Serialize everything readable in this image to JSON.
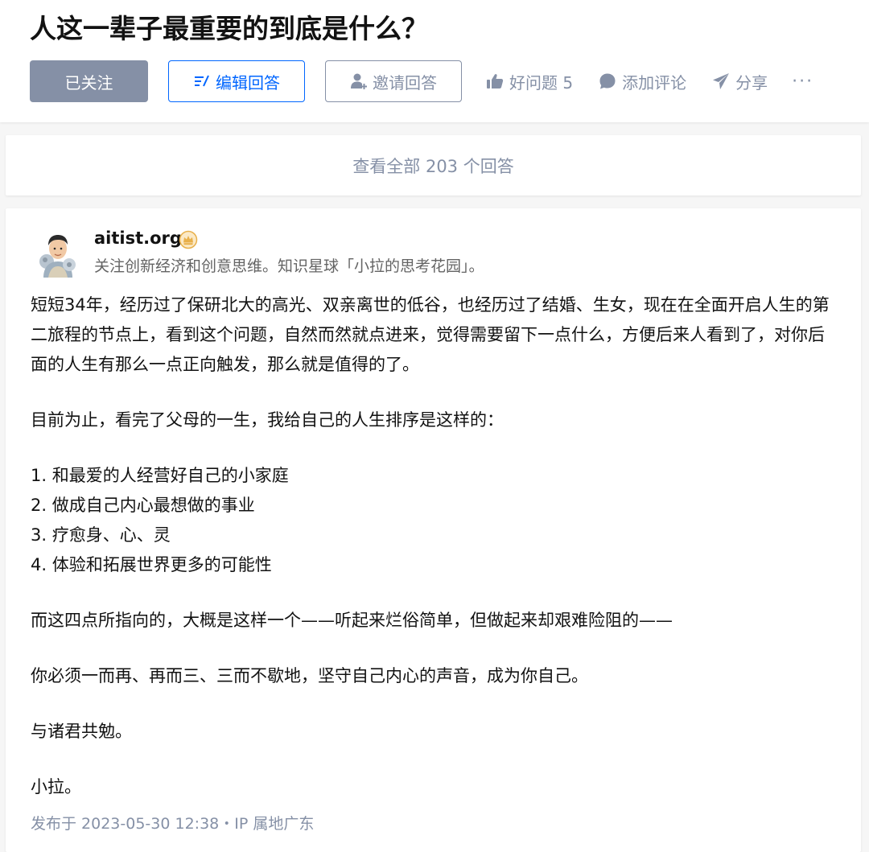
{
  "question": {
    "title": "人这一辈子最重要的到底是什么？"
  },
  "actions": {
    "follow_label": "已关注",
    "edit_label": "编辑回答",
    "invite_label": "邀请回答",
    "good_question_label": "好问题 5",
    "comment_label": "添加评论",
    "share_label": "分享",
    "more_label": "···"
  },
  "view_all": {
    "label": "查看全部 203 个回答"
  },
  "answer": {
    "author": {
      "name": "aitist.org",
      "bio": "关注创新经济和创意思维。知识星球「小拉的思考花园」。"
    },
    "paragraphs": {
      "p1": "短短34年，经历过了保研北大的高光、双亲离世的低谷，也经历过了结婚、生女，现在在全面开启人生的第二旅程的节点上，看到这个问题，自然而然就点进来，觉得需要留下一点什么，方便后来人看到了，对你后面的人生有那么一点正向触发，那么就是值得的了。",
      "p2": "目前为止，看完了父母的一生，我给自己的人生排序是这样的：",
      "list": [
        "1. 和最爱的人经营好自己的小家庭",
        "2. 做成自己内心最想做的事业",
        "3. 疗愈身、心、灵",
        "4. 体验和拓展世界更多的可能性"
      ],
      "p3": "而这四点所指向的，大概是这样一个——听起来烂俗简单，但做起来却艰难险阻的——",
      "p4": "你必须一而再、再而三、三而不歇地，坚守自己内心的声音，成为你自己。",
      "p5": "与诸君共勉。",
      "p6": "小拉。"
    },
    "published": "发布于 2023-05-30 12:38・IP 属地广东"
  },
  "colors": {
    "accent_blue": "#0066ff",
    "muted_gray": "#8590a6",
    "follow_button_bg": "#8590a6",
    "page_bg": "#f6f6f6",
    "badge_gold": "#e8b04a"
  },
  "icons": {
    "edit": "edit-icon",
    "invite": "add-user-icon",
    "good_question": "thumb-up-icon",
    "comment": "comment-bubble-icon",
    "share": "paper-plane-icon",
    "badge": "author-badge-icon"
  }
}
